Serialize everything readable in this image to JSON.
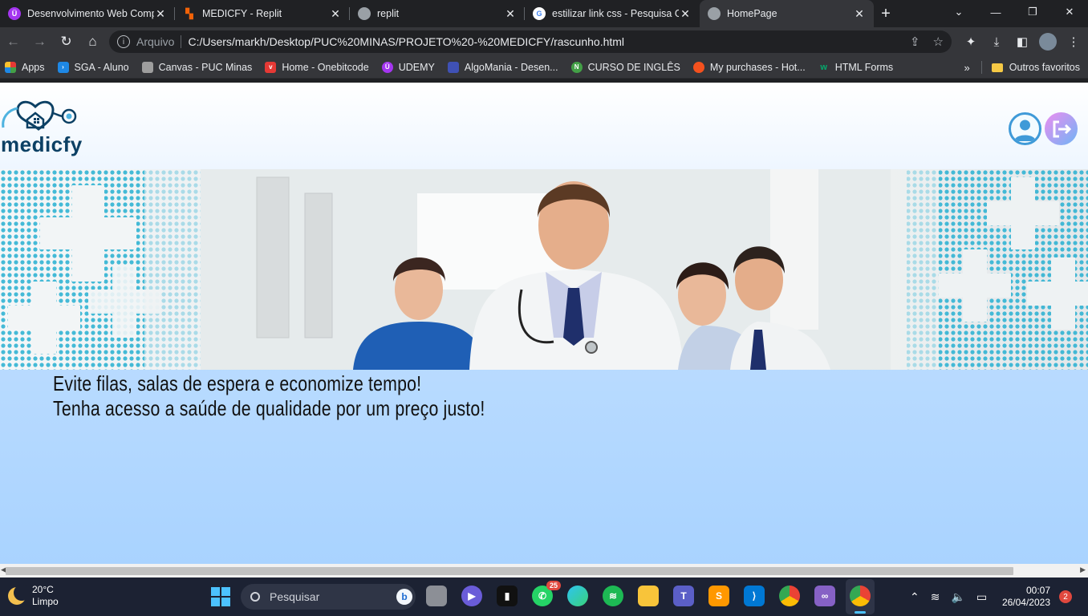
{
  "browser": {
    "tabs": [
      {
        "title": "Desenvolvimento Web Comp",
        "icon": "udemy-icon",
        "color": "#a435f0",
        "glyph": "Ü"
      },
      {
        "title": "MEDICFY - Replit",
        "icon": "replit-icon",
        "color": "#f26207",
        "glyph": "▚"
      },
      {
        "title": "replit",
        "icon": "globe-icon",
        "color": "#5f6368",
        "glyph": "◍"
      },
      {
        "title": "estilizar link css - Pesquisa Go",
        "icon": "google-icon",
        "color": "#ffffff",
        "glyph": "G"
      },
      {
        "title": "HomePage",
        "icon": "globe-icon",
        "color": "#5f6368",
        "glyph": "◍",
        "active": true
      }
    ],
    "new_tab": "+",
    "address": {
      "scheme_label": "Arquivo",
      "url": "C:/Users/markh/Desktop/PUC%20MINAS/PROJETO%20-%20MEDICFY/rascunho.html"
    },
    "bookmarks": [
      {
        "label": "Apps",
        "icon": "apps-grid-icon",
        "color": "#e57373"
      },
      {
        "label": "SGA - Aluno",
        "icon": "sga-icon",
        "color": "#1e88e5"
      },
      {
        "label": "Canvas - PUC Minas",
        "icon": "canvas-icon",
        "color": "#9e9e9e"
      },
      {
        "label": "Home - Onebitcode",
        "icon": "onebitcode-icon",
        "color": "#e53935"
      },
      {
        "label": "UDEMY",
        "icon": "udemy-icon",
        "color": "#a435f0"
      },
      {
        "label": "AlgoMania - Desen...",
        "icon": "algomania-icon",
        "color": "#3f51b5"
      },
      {
        "label": "CURSO DE INGLÊS",
        "icon": "curso-icon",
        "color": "#43a047"
      },
      {
        "label": "My purchases - Hot...",
        "icon": "hotmart-icon",
        "color": "#f4511e"
      },
      {
        "label": "HTML Forms",
        "icon": "w3schools-icon",
        "color": "#04aa6d"
      }
    ],
    "bookmarks_more": "»",
    "other_bookmarks": "Outros favoritos"
  },
  "page": {
    "logo_text": "medicfy",
    "tagline_line1": "Evite filas, salas de espera e economize tempo!",
    "tagline_line2": "Tenha acesso a saúde de qualidade por um preço justo!",
    "colors": {
      "brand": "#0c4064",
      "accent": "#3f9ad8",
      "background": "#b8dcff"
    }
  },
  "taskbar": {
    "weather_temp": "20°C",
    "weather_desc": "Limpo",
    "search_placeholder": "Pesquisar",
    "whatsapp_badge": "25",
    "time": "00:07",
    "date": "26/04/2023",
    "notifications": "2"
  }
}
